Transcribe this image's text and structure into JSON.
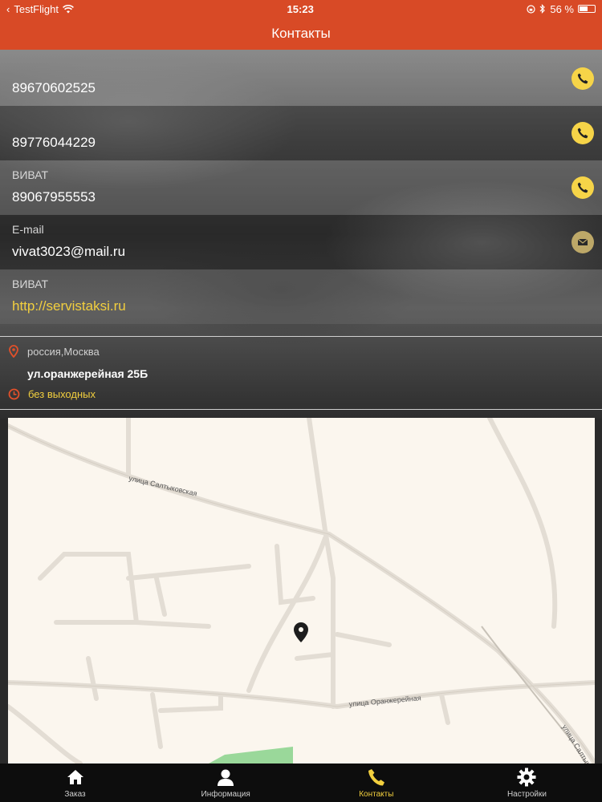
{
  "status_bar": {
    "back_app": "TestFlight",
    "time": "15:23",
    "battery_text": "56 %",
    "battery_level": 0.56
  },
  "header": {
    "title": "Контакты"
  },
  "contacts": [
    {
      "label": "",
      "value": "89670602525",
      "action": "phone-icon"
    },
    {
      "label": "",
      "value": "89776044229",
      "action": "phone-icon"
    },
    {
      "label": "ВИВАТ",
      "value": "89067955553",
      "action": "phone-icon"
    },
    {
      "label": "E-mail",
      "value": "vivat3023@mail.ru",
      "action": "mail-icon"
    },
    {
      "label": "ВИВАТ",
      "value": "http://servistaksi.ru",
      "action": ""
    }
  ],
  "address": {
    "city": "россия,Москва",
    "street": "ул.оранжерейная 25Б",
    "hours": "без выходных"
  },
  "map": {
    "streets": [
      "улица Салтыковская",
      "улица Оранжерейная",
      "улица Салтыковская"
    ]
  },
  "tabs": [
    {
      "label": "Заказ",
      "icon": "home-icon"
    },
    {
      "label": "Информация",
      "icon": "person-icon"
    },
    {
      "label": "Контакты",
      "icon": "phone-icon"
    },
    {
      "label": "Настройки",
      "icon": "gear-icon"
    }
  ],
  "colors": {
    "accent": "#d84a26",
    "highlight": "#f2cf3e",
    "tab_bar": "#0d0d0d"
  }
}
